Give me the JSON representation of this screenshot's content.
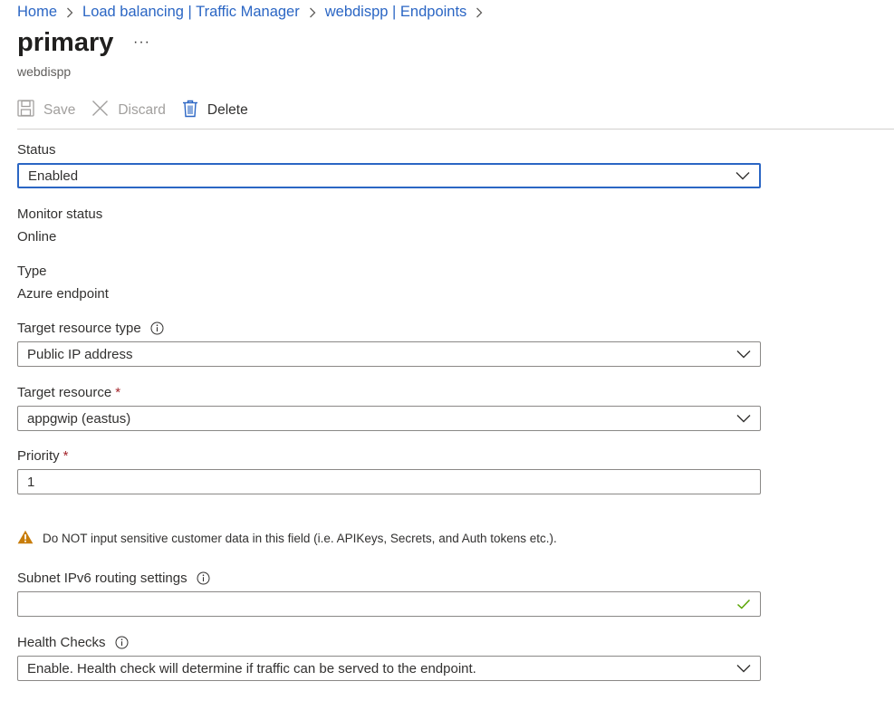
{
  "breadcrumb": {
    "items": [
      "Home",
      "Load balancing | Traffic Manager",
      "webdispp | Endpoints"
    ]
  },
  "header": {
    "title": "primary",
    "subtitle": "webdispp",
    "more_label": "···"
  },
  "toolbar": {
    "save_label": "Save",
    "discard_label": "Discard",
    "delete_label": "Delete"
  },
  "form": {
    "status": {
      "label": "Status",
      "value": "Enabled"
    },
    "monitor_status": {
      "label": "Monitor status",
      "value": "Online"
    },
    "type": {
      "label": "Type",
      "value": "Azure endpoint"
    },
    "target_resource_type": {
      "label": "Target resource type",
      "value": "Public IP address"
    },
    "target_resource": {
      "label": "Target resource",
      "required_mark": "*",
      "value": "appgwip (eastus)"
    },
    "priority": {
      "label": "Priority",
      "required_mark": "*",
      "value": "1"
    },
    "warning": "Do NOT input sensitive customer data in this field (i.e. APIKeys, Secrets, and Auth tokens etc.).",
    "subnet_ipv6": {
      "label": "Subnet IPv6 routing settings",
      "value": ""
    },
    "health_checks": {
      "label": "Health Checks",
      "value": "Enable. Health check will determine if traffic can be served to the endpoint."
    }
  },
  "colors": {
    "link": "#2b66c4",
    "warning_icon": "#c87d0a",
    "valid_check": "#57a300",
    "required": "#a4262c"
  },
  "icons": [
    "chevron-right-icon",
    "more-icon",
    "save-icon",
    "discard-icon",
    "delete-icon",
    "chevron-down-icon",
    "info-icon",
    "warning-icon",
    "checkmark-icon"
  ]
}
